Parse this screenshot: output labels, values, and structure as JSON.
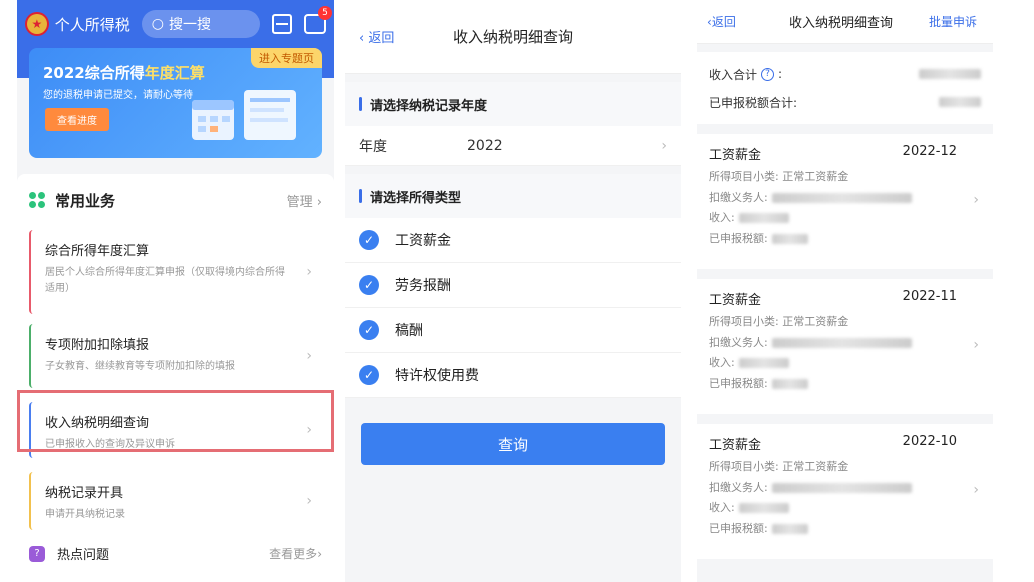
{
  "panel1": {
    "app_title": "个人所得税",
    "search_placeholder": "搜一搜",
    "msg_badge": "5",
    "banner": {
      "tag": "进入专题页",
      "title_prefix": "2022综合所得",
      "title_highlight": "年度汇算",
      "subtitle": "您的退税申请已提交，请耐心等待",
      "button": "查看进度"
    },
    "section_title": "常用业务",
    "manage": "管理",
    "services": [
      {
        "title": "综合所得年度汇算",
        "desc": "居民个人综合所得年度汇算申报（仅取得境内综合所得适用）",
        "accent": "#e85a6b"
      },
      {
        "title": "专项附加扣除填报",
        "desc": "子女教育、继续教育等专项附加扣除的填报",
        "accent": "#4caf6a"
      },
      {
        "title": "收入纳税明细查询",
        "desc": "已申报收入的查询及异议申诉",
        "accent": "#4a7ef0"
      },
      {
        "title": "纳税记录开具",
        "desc": "申请开具纳税记录",
        "accent": "#f2c14e"
      }
    ],
    "hot": {
      "title": "热点问题",
      "more": "查看更多"
    }
  },
  "panel2": {
    "back": "返回",
    "title": "收入纳税明细查询",
    "year_section": "请选择纳税记录年度",
    "year_label": "年度",
    "year_value": "2022",
    "type_section": "请选择所得类型",
    "types": [
      "工资薪金",
      "劳务报酬",
      "稿酬",
      "特许权使用费"
    ],
    "query_button": "查询"
  },
  "panel3": {
    "back": "返回",
    "title": "收入纳税明细查询",
    "batch": "批量申诉",
    "income_total_label": "收入合计",
    "tax_total_label": "已申报税额合计:",
    "records": [
      {
        "title": "工资薪金",
        "date": "2022-12",
        "sub_label": "所得项目小类:",
        "sub_value": "正常工资薪金",
        "withholder_label": "扣缴义务人:",
        "income_label": "收入:",
        "tax_label": "已申报税额:"
      },
      {
        "title": "工资薪金",
        "date": "2022-11",
        "sub_label": "所得项目小类:",
        "sub_value": "正常工资薪金",
        "withholder_label": "扣缴义务人:",
        "income_label": "收入:",
        "tax_label": "已申报税额:"
      },
      {
        "title": "工资薪金",
        "date": "2022-10",
        "sub_label": "所得项目小类:",
        "sub_value": "正常工资薪金",
        "withholder_label": "扣缴义务人:",
        "income_label": "收入:",
        "tax_label": "已申报税额:"
      }
    ]
  },
  "colors": {
    "brand": "#3a6ee8",
    "highlight_box": "#e56d74",
    "check": "#3a7ff0"
  }
}
